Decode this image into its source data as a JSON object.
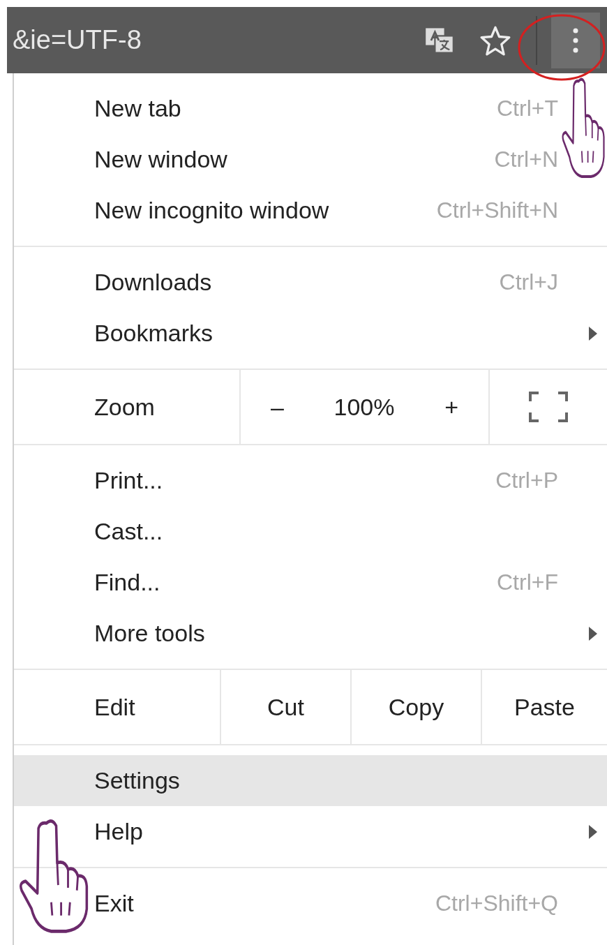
{
  "toolbar": {
    "url_fragment": "&ie=UTF-8"
  },
  "menu": {
    "sections": [
      {
        "kind": "items",
        "items": [
          {
            "label": "New tab",
            "shortcut": "Ctrl+T",
            "has_submenu": false,
            "highlighted": false
          },
          {
            "label": "New window",
            "shortcut": "Ctrl+N",
            "has_submenu": false,
            "highlighted": false
          },
          {
            "label": "New incognito window",
            "shortcut": "Ctrl+Shift+N",
            "has_submenu": false,
            "highlighted": false
          }
        ]
      },
      {
        "kind": "items",
        "items": [
          {
            "label": "Downloads",
            "shortcut": "Ctrl+J",
            "has_submenu": false,
            "highlighted": false
          },
          {
            "label": "Bookmarks",
            "has_submenu": true,
            "highlighted": false
          }
        ]
      },
      {
        "kind": "zoom",
        "label": "Zoom",
        "minus": "–",
        "value": "100%",
        "plus": "+"
      },
      {
        "kind": "items",
        "items": [
          {
            "label": "Print...",
            "shortcut": "Ctrl+P",
            "has_submenu": false,
            "highlighted": false
          },
          {
            "label": "Cast...",
            "has_submenu": false,
            "highlighted": false
          },
          {
            "label": "Find...",
            "shortcut": "Ctrl+F",
            "has_submenu": false,
            "highlighted": false
          },
          {
            "label": "More tools",
            "has_submenu": true,
            "highlighted": false
          }
        ]
      },
      {
        "kind": "edit",
        "label": "Edit",
        "buttons": [
          "Cut",
          "Copy",
          "Paste"
        ]
      },
      {
        "kind": "items",
        "items": [
          {
            "label": "Settings",
            "has_submenu": false,
            "highlighted": true
          },
          {
            "label": "Help",
            "has_submenu": true,
            "highlighted": false
          }
        ]
      },
      {
        "kind": "items",
        "items": [
          {
            "label": "Exit",
            "shortcut": "Ctrl+Shift+Q",
            "has_submenu": false,
            "highlighted": false
          }
        ]
      }
    ]
  }
}
